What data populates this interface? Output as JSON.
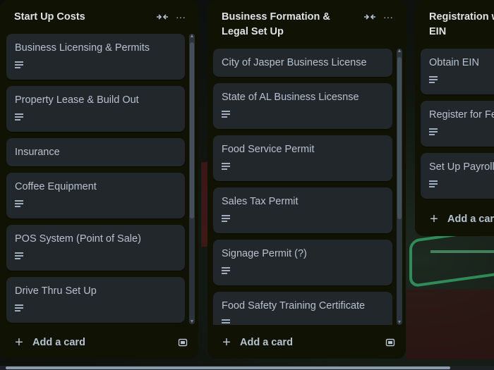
{
  "lists": [
    {
      "title": "Start Up Costs",
      "add_card_label": "Add a card",
      "cards": [
        {
          "label": "Business Licensing & Permits",
          "has_description": true
        },
        {
          "label": "Property Lease & Build Out",
          "has_description": true
        },
        {
          "label": "Insurance",
          "has_description": false
        },
        {
          "label": "Coffee Equipment",
          "has_description": true
        },
        {
          "label": "POS System (Point of Sale)",
          "has_description": true
        },
        {
          "label": "Drive Thru Set Up",
          "has_description": true
        }
      ]
    },
    {
      "title": "Business Formation & Legal Set Up",
      "add_card_label": "Add a card",
      "cards": [
        {
          "label": "City of Jasper Business License",
          "has_description": false
        },
        {
          "label": "State of AL Business Licesnse",
          "has_description": true
        },
        {
          "label": "Food Service Permit",
          "has_description": true
        },
        {
          "label": "Sales Tax Permit",
          "has_description": true
        },
        {
          "label": "Signage Permit (?)",
          "has_description": true
        },
        {
          "label": "Food Safety Training Certificate",
          "has_description": true
        }
      ]
    },
    {
      "title": "Registration w EIN",
      "add_card_label": "Add a card",
      "cards": [
        {
          "label": "Obtain EIN",
          "has_description": true
        },
        {
          "label": "Register for Fe",
          "has_description": true
        },
        {
          "label": "Set Up Payroll",
          "has_description": true
        }
      ]
    }
  ],
  "icons": {
    "collapse": "collapse-arrows-icon",
    "menu": "ellipsis-icon",
    "add": "plus-icon",
    "template": "card-template-icon",
    "description": "description-lines-icon"
  }
}
